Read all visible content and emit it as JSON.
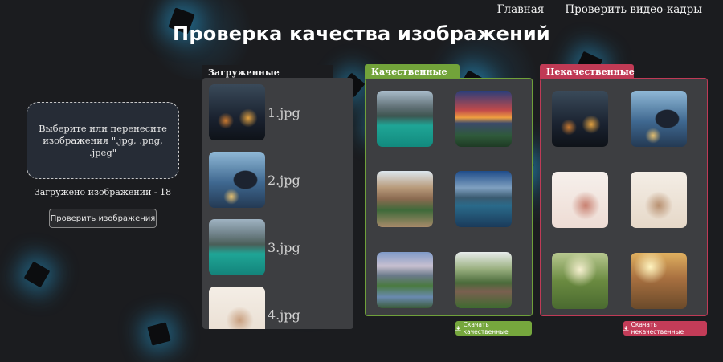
{
  "nav": {
    "home_label": "Главная",
    "video_label": "Проверить видео-кадры"
  },
  "page_title": "Проверка качества изображений",
  "dropzone": {
    "text": "Выберите или перенесите изображения \".jpg, .png, .jpeg\""
  },
  "upload_count_text": "Загружено изображений - 18",
  "check_button_label": "Проверить изображения",
  "uploaded": {
    "label": "Загруженные изображения:",
    "items": [
      {
        "name": "1.jpg",
        "image": "blurry night street with lights"
      },
      {
        "name": "2.jpg",
        "image": "couple at night with bokeh lights"
      },
      {
        "name": "3.jpg",
        "image": "mountain lake with turquoise water and boat"
      },
      {
        "name": "4.jpg",
        "image": "overexposed bright wedding photo"
      }
    ]
  },
  "quality": {
    "label": "Качественные",
    "download_label": "Скачать качественные",
    "images": [
      "mountain lake with turquoise water",
      "sunset over valley",
      "street corner with flowers",
      "alpine lake reflection",
      "lake with mountains and sky",
      "old stone house in park"
    ]
  },
  "non_quality": {
    "label": "Некачественные",
    "download_label": "Скачать некачественные",
    "images": [
      "blurry night street",
      "couple at night blurred",
      "overexposed flowers",
      "overexposed wedding couple",
      "sunlit park path",
      "backlit portrait with flare"
    ]
  },
  "colors": {
    "background": "#1b1c1f",
    "panel": "#3d3e41",
    "quality_accent": "#72a33a",
    "non_quality_accent": "#c03a55",
    "glow": "#28aae6"
  }
}
